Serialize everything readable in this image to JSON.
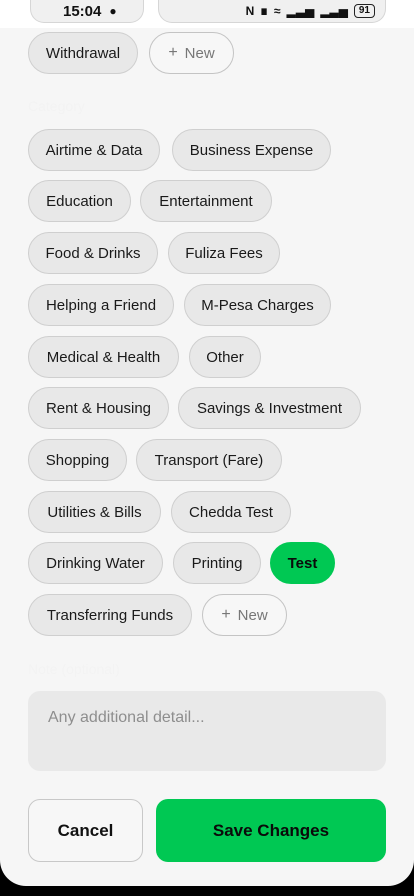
{
  "status_bar": {
    "time": "15:04",
    "icons": [
      "message-icon",
      "nfc-icon",
      "mute-icon",
      "wifi-icon",
      "signal-icon",
      "signal-icon"
    ],
    "battery": "91"
  },
  "type_chips": {
    "withdrawal": "Withdrawal",
    "new": "New"
  },
  "category": {
    "label": "Category",
    "chips": [
      "Airtime & Data",
      "Business Expense",
      "Education",
      "Entertainment",
      "Food & Drinks",
      "Fuliza Fees",
      "Helping a Friend",
      "M-Pesa Charges",
      "Medical & Health",
      "Other",
      "Rent & Housing",
      "Savings & Investment",
      "Shopping",
      "Transport (Fare)",
      "Utilities & Bills",
      "Chedda Test",
      "Drinking Water",
      "Printing",
      "Test",
      "Transferring Funds"
    ],
    "selected": "Test",
    "new": "New"
  },
  "note": {
    "label": "Note (optional)",
    "placeholder": "Any additional detail..."
  },
  "actions": {
    "cancel": "Cancel",
    "save": "Save Changes"
  },
  "colors": {
    "accent": "#00c853",
    "chip_bg": "#e8e8e8",
    "background": "#f6f6f6"
  }
}
